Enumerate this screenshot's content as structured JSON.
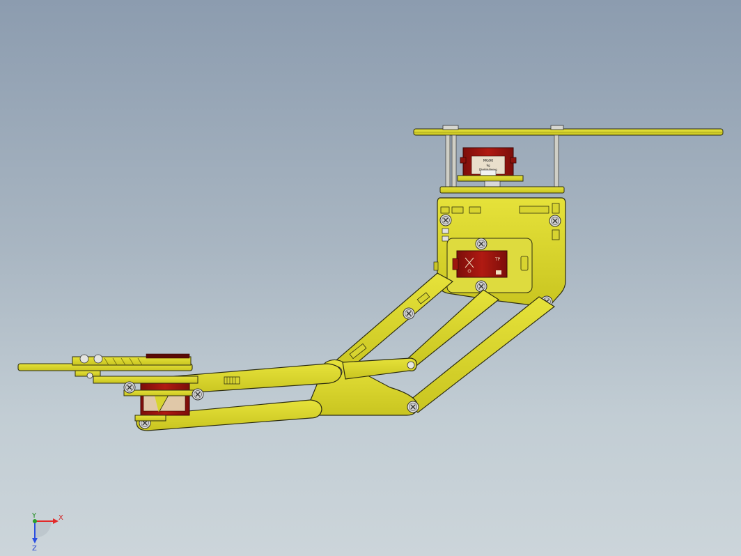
{
  "viewport": {
    "background_top": "#8c9caf",
    "background_bottom": "#ccd5da"
  },
  "colors": {
    "part_yellow": "#d8d42c",
    "part_yellow_dark": "#8d8a12",
    "part_outline": "#2d2d10",
    "servo_red": "#a41812",
    "servo_red_dark": "#6e0c08",
    "servo_label": "#e9dfcb",
    "screw_silver": "#dcdcdc",
    "standoff": "#c8c8c0"
  },
  "model": {
    "description_icon": "robot-arm-assembly-icon"
  },
  "triad": {
    "x_label": "X",
    "y_label": "Y",
    "z_label": "Z",
    "x_color": "#e22a2a",
    "y_color": "#2aa02a",
    "z_color": "#2a4ee2"
  },
  "servo_labels": {
    "top_servo_line1": "MG90",
    "top_servo_line2": "9g",
    "top_servo_line3": "Digital Servo",
    "body_servo_text": "TP"
  }
}
